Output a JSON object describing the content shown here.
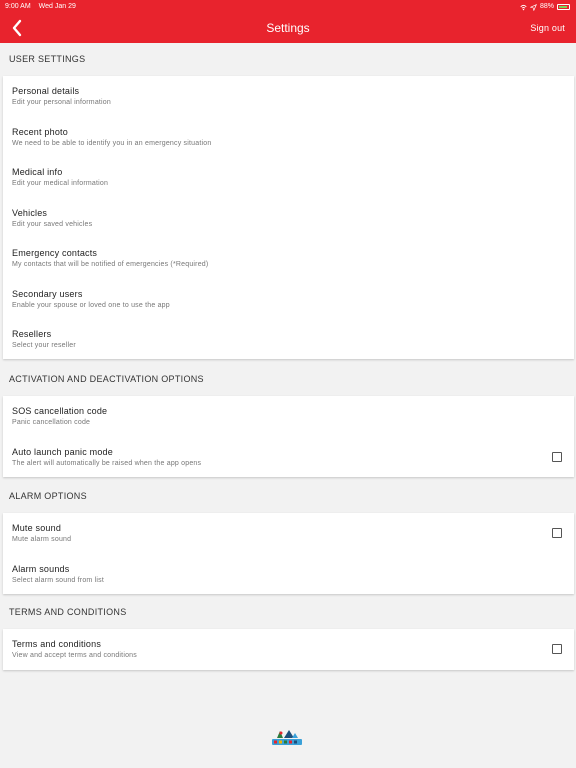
{
  "status_bar": {
    "time": "9:00 AM",
    "date": "Wed Jan 29",
    "battery": "88%"
  },
  "header": {
    "title": "Settings",
    "sign_out": "Sign out"
  },
  "sections": [
    {
      "title": "USER SETTINGS",
      "items": [
        {
          "title": "Personal details",
          "subtitle": "Edit your personal information"
        },
        {
          "title": "Recent photo",
          "subtitle": "We need to be able to identify you in an emergency situation"
        },
        {
          "title": "Medical info",
          "subtitle": "Edit your medical information"
        },
        {
          "title": "Vehicles",
          "subtitle": "Edit your saved vehicles"
        },
        {
          "title": "Emergency contacts",
          "subtitle": "My contacts that will be notified of emergencies (*Required)"
        },
        {
          "title": "Secondary users",
          "subtitle": "Enable your spouse or loved one to use the app"
        },
        {
          "title": "Resellers",
          "subtitle": "Select your reseller"
        }
      ]
    },
    {
      "title": "ACTIVATION AND DEACTIVATION OPTIONS",
      "items": [
        {
          "title": "SOS cancellation code",
          "subtitle": "Panic cancellation code"
        },
        {
          "title": "Auto launch panic mode",
          "subtitle": "The alert will automatically be raised when the app opens",
          "checked": false
        }
      ]
    },
    {
      "title": "ALARM OPTIONS",
      "items": [
        {
          "title": "Mute sound",
          "subtitle": "Mute alarm sound",
          "checked": false
        },
        {
          "title": "Alarm sounds",
          "subtitle": "Select alarm sound from list"
        }
      ]
    },
    {
      "title": "TERMS AND CONDITIONS",
      "items": [
        {
          "title": "Terms and conditions",
          "subtitle": "View and accept terms and conditions",
          "checked": false
        }
      ]
    }
  ],
  "colors": {
    "accent": "#e8232d",
    "background": "#f2f2f2"
  }
}
